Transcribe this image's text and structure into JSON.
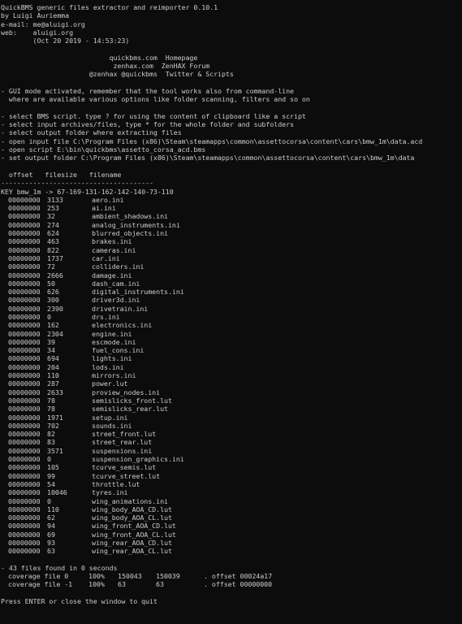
{
  "header": {
    "lines": [
      "QuickBMS generic files extractor and reimporter 0.10.1",
      "by Luigi Auriemma",
      "e-mail: me@aluigi.org",
      "web:    aluigi.org",
      "        (Oct 20 2019 - 14:53:23)"
    ]
  },
  "links": {
    "lines": [
      "                           quickbms.com  Homepage",
      "                            zenhax.com  ZenHAX Forum",
      "                      @zenhax @quickbms  Twitter & Scripts"
    ]
  },
  "gui_notice": {
    "lines": [
      "- GUI mode activated, remember that the tool works also from command-line",
      "  where are available various options like folder scanning, filters and so on"
    ]
  },
  "steps": {
    "lines": [
      "- select BMS script. type ? for using the content of clipboard like a script",
      "- select input archives/files, type * for the whole folder and subfolders",
      "- select output folder where extracting files",
      "- open input file C:\\Program Files (x86)\\Steam\\steamapps\\common\\assettocorsa\\content\\cars\\bmw_1m\\data.acd",
      "- open script E:\\bin\\quickbms\\assetto_corsa_acd.bms",
      "- set output folder C:\\Program Files (x86)\\Steam\\steamapps\\common\\assettocorsa\\content\\cars\\bmw_1m\\data"
    ]
  },
  "table": {
    "header": "  offset   filesize   filename",
    "separator": "--------------------------------------",
    "key_line": "KEY bmw_1m -> 67-169-131-162-142-140-73-110",
    "rows": [
      [
        "00000000",
        "3133",
        "aero.ini"
      ],
      [
        "00000000",
        "253",
        "ai.ini"
      ],
      [
        "00000000",
        "32",
        "ambient_shadows.ini"
      ],
      [
        "00000000",
        "274",
        "analog_instruments.ini"
      ],
      [
        "00000000",
        "624",
        "blurred_objects.ini"
      ],
      [
        "00000000",
        "463",
        "brakes.ini"
      ],
      [
        "00000000",
        "822",
        "cameras.ini"
      ],
      [
        "00000000",
        "1737",
        "car.ini"
      ],
      [
        "00000000",
        "72",
        "colliders.ini"
      ],
      [
        "00000000",
        "2666",
        "damage.ini"
      ],
      [
        "00000000",
        "50",
        "dash_cam.ini"
      ],
      [
        "00000000",
        "626",
        "digital_instruments.ini"
      ],
      [
        "00000000",
        "300",
        "driver3d.ini"
      ],
      [
        "00000000",
        "2390",
        "drivetrain.ini"
      ],
      [
        "00000000",
        "0",
        "drs.ini"
      ],
      [
        "00000000",
        "162",
        "electronics.ini"
      ],
      [
        "00000000",
        "2304",
        "engine.ini"
      ],
      [
        "00000000",
        "39",
        "escmode.ini"
      ],
      [
        "00000000",
        "34",
        "fuel_cons.ini"
      ],
      [
        "00000000",
        "694",
        "lights.ini"
      ],
      [
        "00000000",
        "204",
        "lods.ini"
      ],
      [
        "00000000",
        "110",
        "mirrors.ini"
      ],
      [
        "00000000",
        "287",
        "power.lut"
      ],
      [
        "00000000",
        "2633",
        "proview_nodes.ini"
      ],
      [
        "00000000",
        "78",
        "semislicks_front.lut"
      ],
      [
        "00000000",
        "78",
        "semislicks_rear.lut"
      ],
      [
        "00000000",
        "1971",
        "setup.ini"
      ],
      [
        "00000000",
        "702",
        "sounds.ini"
      ],
      [
        "00000000",
        "82",
        "street_front.lut"
      ],
      [
        "00000000",
        "83",
        "street_rear.lut"
      ],
      [
        "00000000",
        "3571",
        "suspensions.ini"
      ],
      [
        "00000000",
        "0",
        "suspension_graphics.ini"
      ],
      [
        "00000000",
        "105",
        "tcurve_semis.lut"
      ],
      [
        "00000000",
        "99",
        "tcurve_street.lut"
      ],
      [
        "00000000",
        "54",
        "throttle.lut"
      ],
      [
        "00000000",
        "10046",
        "tyres.ini"
      ],
      [
        "00000000",
        "0",
        "wing_animations.ini"
      ],
      [
        "00000000",
        "110",
        "wing_body_AOA_CD.lut"
      ],
      [
        "00000000",
        "62",
        "wing_body_AOA_CL.lut"
      ],
      [
        "00000000",
        "94",
        "wing_front_AOA_CD.lut"
      ],
      [
        "00000000",
        "69",
        "wing_front_AOA_CL.lut"
      ],
      [
        "00000000",
        "93",
        "wing_rear_AOA_CD.lut"
      ],
      [
        "00000000",
        "63",
        "wing_rear_AOA_CL.lut"
      ]
    ]
  },
  "summary": {
    "found": "- 43 files found in 0 seconds",
    "coverage": [
      [
        "coverage file 0",
        "100%",
        "150043",
        "150039",
        ". offset 00024a17"
      ],
      [
        "coverage file -1",
        "100%",
        "63",
        "63",
        ". offset 00000000"
      ]
    ]
  },
  "prompt": "Press ENTER or close the window to quit",
  "colors": {
    "background": "#0c0c0c",
    "text": "#cccccc"
  }
}
